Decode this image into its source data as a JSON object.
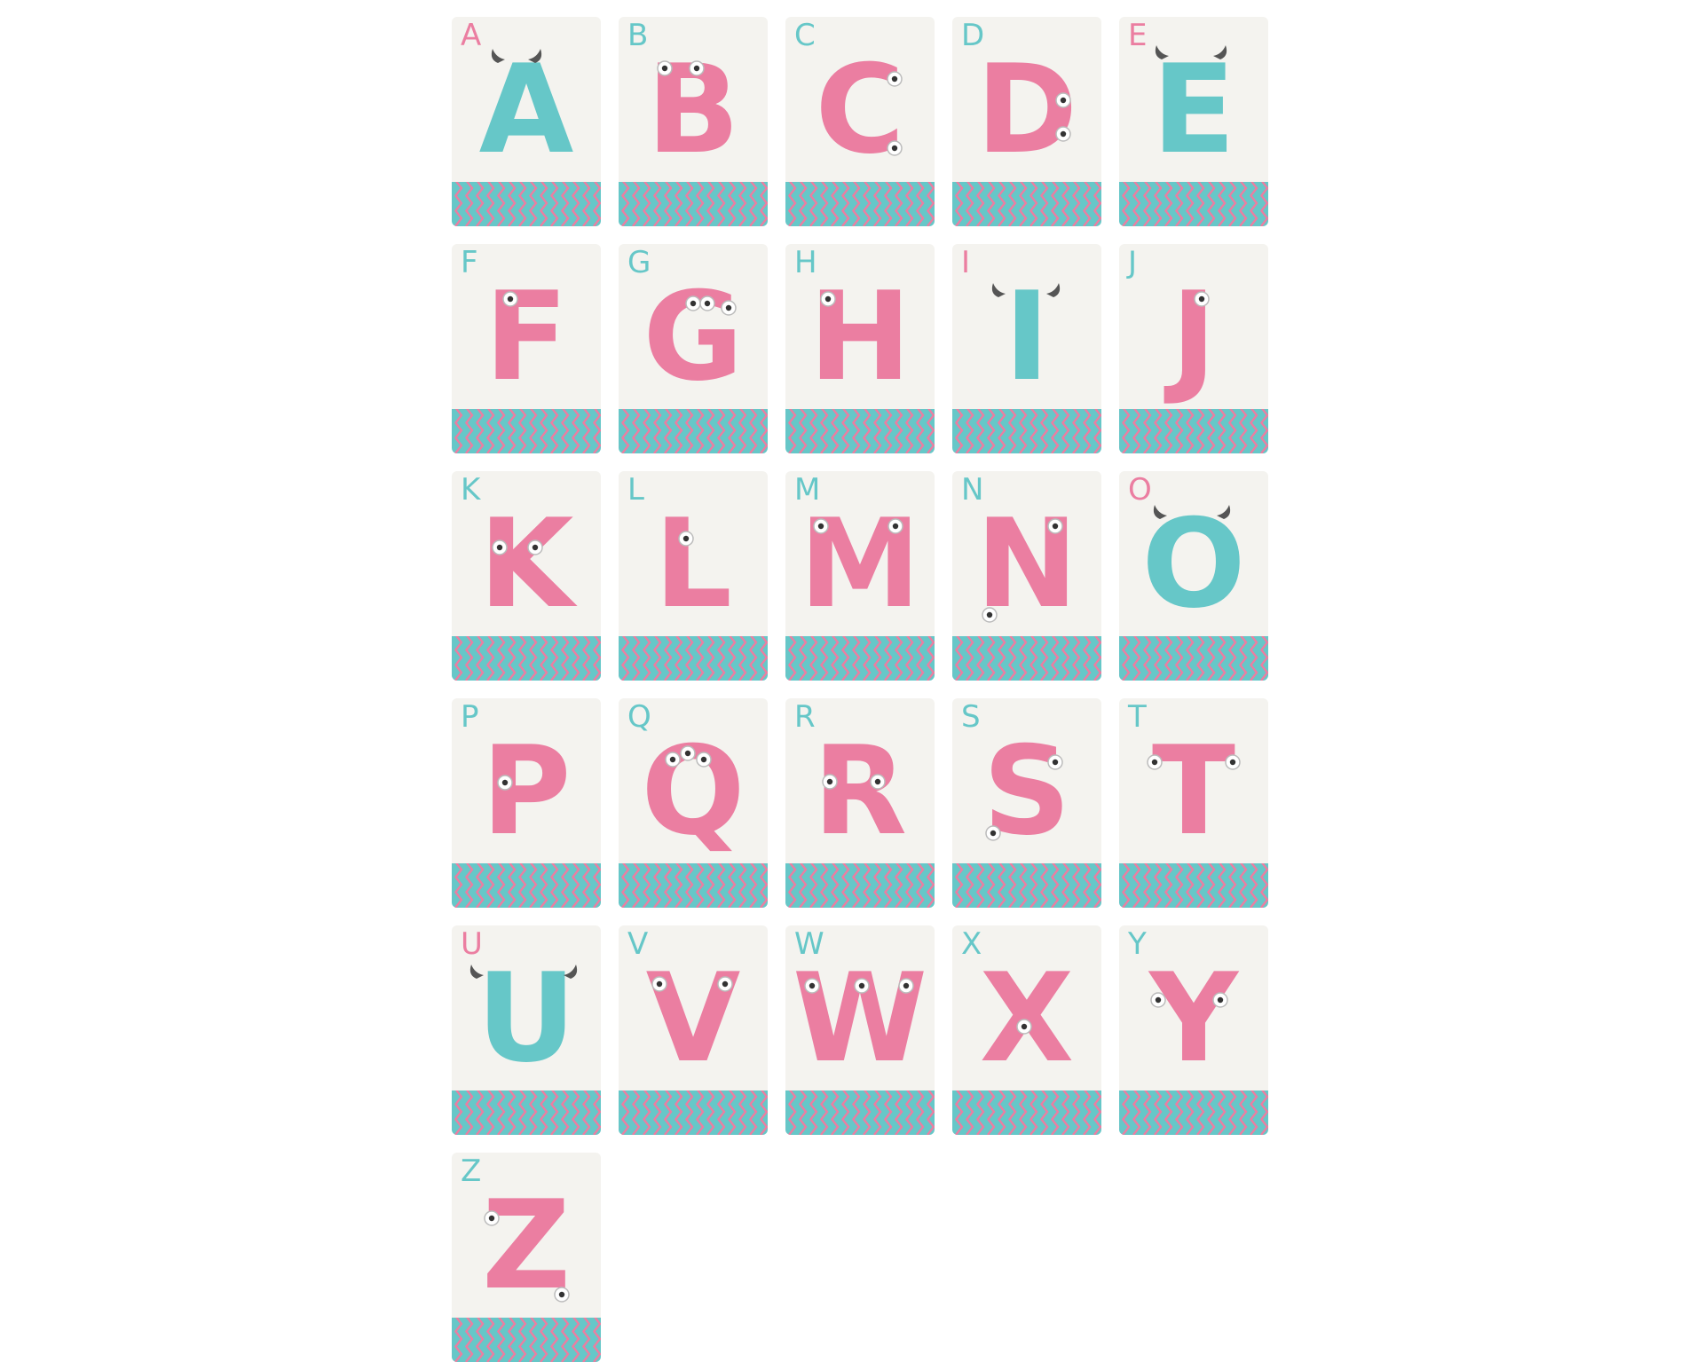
{
  "colors": {
    "pink": "#eb7ea1",
    "teal": "#66c7c8",
    "card": "#f4f3ef",
    "horn": "#555555"
  },
  "cards": [
    {
      "corner": "A",
      "letter": "A",
      "color": "teal",
      "corner_color": "pink",
      "feature": "horns"
    },
    {
      "corner": "B",
      "letter": "B",
      "color": "pink",
      "corner_color": "teal",
      "feature": "eyes"
    },
    {
      "corner": "C",
      "letter": "C",
      "color": "pink",
      "corner_color": "teal",
      "feature": "eyes"
    },
    {
      "corner": "D",
      "letter": "D",
      "color": "pink",
      "corner_color": "teal",
      "feature": "eyes"
    },
    {
      "corner": "E",
      "letter": "E",
      "color": "teal",
      "corner_color": "pink",
      "feature": "horns"
    },
    {
      "corner": "F",
      "letter": "F",
      "color": "pink",
      "corner_color": "teal",
      "feature": "eyes"
    },
    {
      "corner": "G",
      "letter": "G",
      "color": "pink",
      "corner_color": "teal",
      "feature": "eyes"
    },
    {
      "corner": "H",
      "letter": "H",
      "color": "pink",
      "corner_color": "teal",
      "feature": "eyes"
    },
    {
      "corner": "I",
      "letter": "I",
      "color": "teal",
      "corner_color": "pink",
      "feature": "horns"
    },
    {
      "corner": "J",
      "letter": "J",
      "color": "pink",
      "corner_color": "teal",
      "feature": "eyes"
    },
    {
      "corner": "K",
      "letter": "K",
      "color": "pink",
      "corner_color": "teal",
      "feature": "eyes"
    },
    {
      "corner": "L",
      "letter": "L",
      "color": "pink",
      "corner_color": "teal",
      "feature": "eyes"
    },
    {
      "corner": "M",
      "letter": "M",
      "color": "pink",
      "corner_color": "teal",
      "feature": "eyes"
    },
    {
      "corner": "N",
      "letter": "N",
      "color": "pink",
      "corner_color": "teal",
      "feature": "eyes"
    },
    {
      "corner": "O",
      "letter": "O",
      "color": "teal",
      "corner_color": "pink",
      "feature": "horns"
    },
    {
      "corner": "P",
      "letter": "P",
      "color": "pink",
      "corner_color": "teal",
      "feature": "eyes"
    },
    {
      "corner": "Q",
      "letter": "Q",
      "color": "pink",
      "corner_color": "teal",
      "feature": "eyes"
    },
    {
      "corner": "R",
      "letter": "R",
      "color": "pink",
      "corner_color": "teal",
      "feature": "eyes"
    },
    {
      "corner": "S",
      "letter": "S",
      "color": "pink",
      "corner_color": "teal",
      "feature": "eyes"
    },
    {
      "corner": "T",
      "letter": "T",
      "color": "pink",
      "corner_color": "teal",
      "feature": "eyes"
    },
    {
      "corner": "U",
      "letter": "U",
      "color": "teal",
      "corner_color": "pink",
      "feature": "horns"
    },
    {
      "corner": "V",
      "letter": "V",
      "color": "pink",
      "corner_color": "teal",
      "feature": "eyes"
    },
    {
      "corner": "W",
      "letter": "W",
      "color": "pink",
      "corner_color": "teal",
      "feature": "eyes"
    },
    {
      "corner": "X",
      "letter": "X",
      "color": "pink",
      "corner_color": "teal",
      "feature": "eyes"
    },
    {
      "corner": "Y",
      "letter": "Y",
      "color": "pink",
      "corner_color": "teal",
      "feature": "eyes"
    },
    {
      "corner": "Z",
      "letter": "Z",
      "color": "pink",
      "corner_color": "teal",
      "feature": "eyes"
    }
  ]
}
